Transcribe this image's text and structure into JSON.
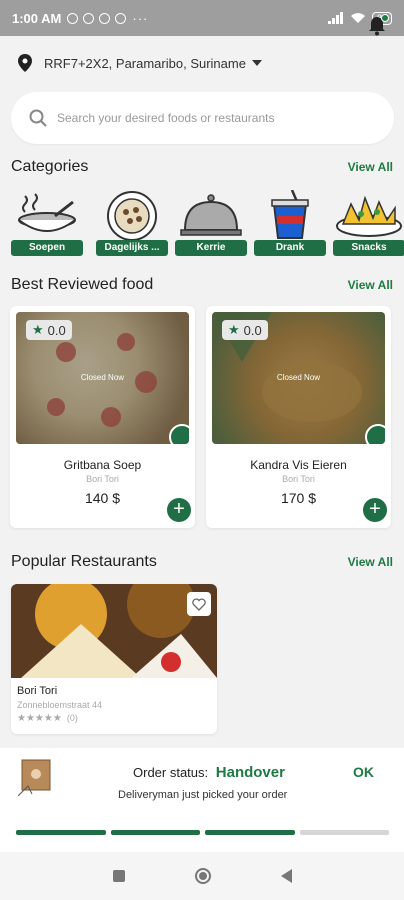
{
  "status_bar": {
    "time": "1:00 AM",
    "battery": "84"
  },
  "header": {
    "location": "RRF7+2X2, Paramaribo, Suriname"
  },
  "search": {
    "placeholder": "Search your desired foods or restaurants"
  },
  "categories": {
    "title": "Categories",
    "view_all": "View All",
    "items": [
      {
        "label": "Soepen",
        "icon": "soup-bowl-icon"
      },
      {
        "label": "Dagelijks ...",
        "icon": "plate-icon"
      },
      {
        "label": "Kerrie",
        "icon": "cloche-icon"
      },
      {
        "label": "Drank",
        "icon": "drink-cup-icon"
      },
      {
        "label": "Snacks",
        "icon": "snack-plate-icon"
      }
    ]
  },
  "best_reviewed": {
    "title": "Best Reviewed food",
    "view_all": "View All",
    "items": [
      {
        "name": "Gritbana Soep",
        "restaurant": "Bori Tori",
        "price": "140 $",
        "rating": "0.0",
        "status": "Closed Now"
      },
      {
        "name": "Kandra Vis Eieren",
        "restaurant": "Bori Tori",
        "price": "170 $",
        "rating": "0.0",
        "status": "Closed Now"
      }
    ]
  },
  "popular_restaurants": {
    "title": "Popular Restaurants",
    "view_all": "View All",
    "items": [
      {
        "name": "Bori Tori",
        "address": "Zonnebloemstraat 44",
        "stars": "★★★★★",
        "reviews": "(0)"
      }
    ]
  },
  "order_status": {
    "label": "Order status:",
    "status": "Handover",
    "ok": "OK",
    "message": "Deliveryman just picked your order",
    "steps_done": 3,
    "steps_total": 4
  },
  "colors": {
    "accent": "#1f6e45",
    "accent_text": "#1f7a43"
  }
}
